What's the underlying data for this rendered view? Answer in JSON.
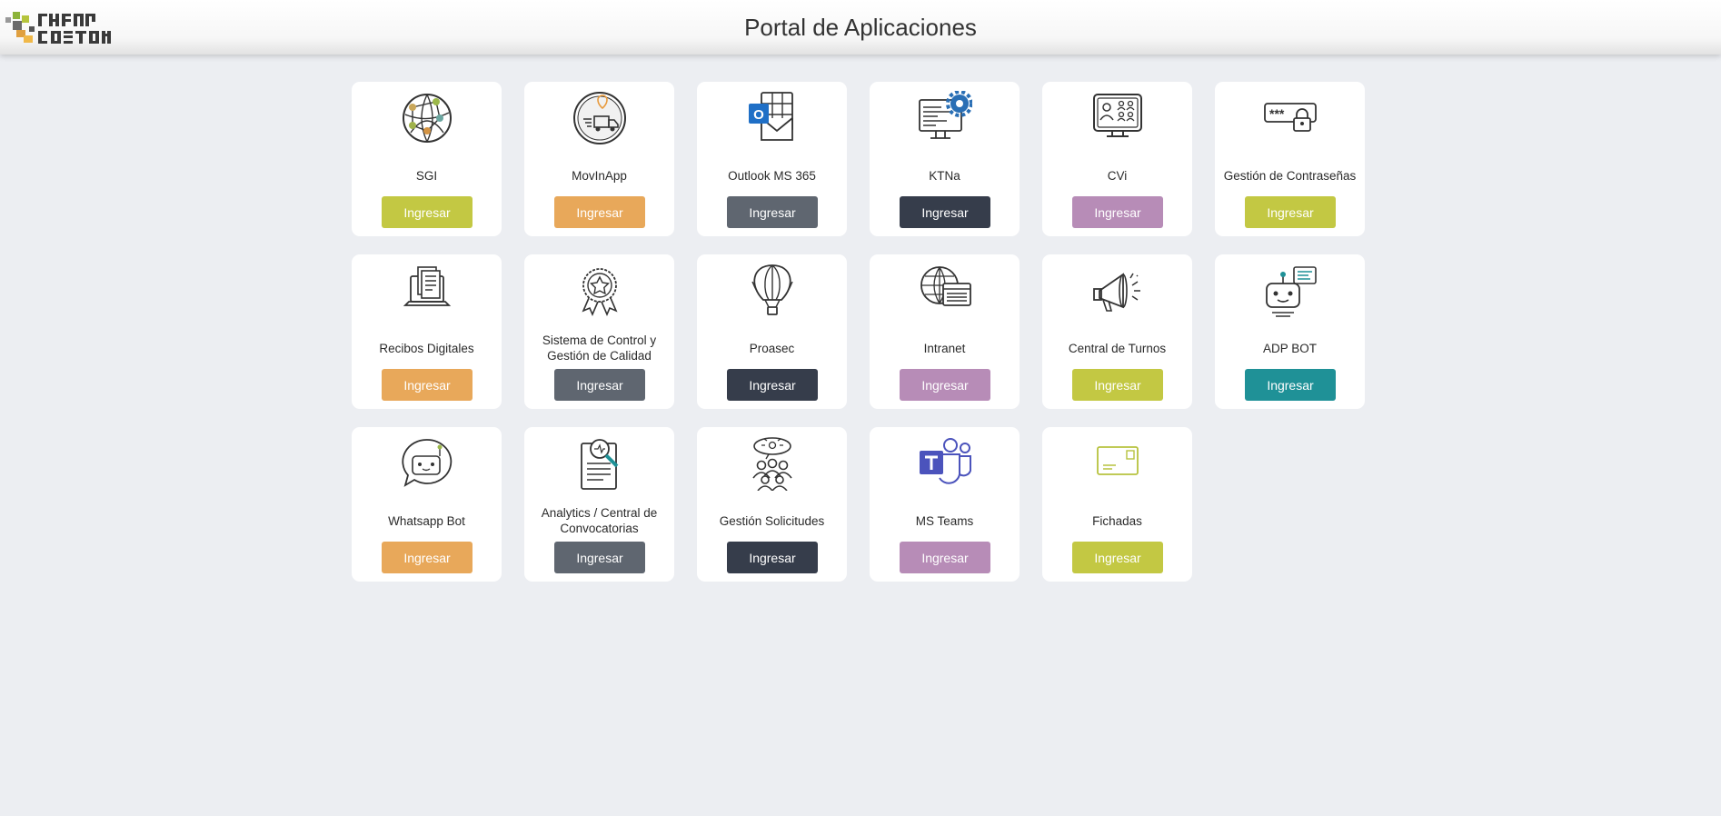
{
  "header": {
    "title": "Portal de Aplicaciones"
  },
  "colors": {
    "lime": "#c3c843",
    "orange": "#e8a85a",
    "slate": "#5f6670",
    "navy": "#363d4b",
    "mauve": "#b78cb7",
    "teal": "#1f9197",
    "card_bg": "#ffffff",
    "page_bg": "#eceef2"
  },
  "apps": [
    {
      "label": "SGI",
      "button": "Ingresar",
      "icon": "network-globe-icon",
      "color": "lime"
    },
    {
      "label": "MovInApp",
      "button": "Ingresar",
      "icon": "delivery-truck-icon",
      "color": "orange"
    },
    {
      "label": "Outlook MS 365",
      "button": "Ingresar",
      "icon": "outlook-icon",
      "color": "slate"
    },
    {
      "label": "KTNa",
      "button": "Ingresar",
      "icon": "monitor-gear-icon",
      "color": "navy"
    },
    {
      "label": "CVi",
      "button": "Ingresar",
      "icon": "monitor-people-icon",
      "color": "mauve"
    },
    {
      "label": "Gestión de Contraseñas",
      "button": "Ingresar",
      "icon": "password-lock-icon",
      "color": "lime"
    },
    {
      "label": "Recibos Digitales",
      "button": "Ingresar",
      "icon": "laptop-documents-icon",
      "color": "orange"
    },
    {
      "label": "Sistema de Control y Gestión de Calidad",
      "button": "Ingresar",
      "icon": "quality-badge-icon",
      "color": "slate"
    },
    {
      "label": "Proasec",
      "button": "Ingresar",
      "icon": "hot-air-balloon-icon",
      "color": "navy"
    },
    {
      "label": "Intranet",
      "button": "Ingresar",
      "icon": "globe-window-icon",
      "color": "mauve"
    },
    {
      "label": "Central de Turnos",
      "button": "Ingresar",
      "icon": "megaphone-icon",
      "color": "lime"
    },
    {
      "label": "ADP BOT",
      "button": "Ingresar",
      "icon": "robot-chat-icon",
      "color": "teal"
    },
    {
      "label": "Whatsapp Bot",
      "button": "Ingresar",
      "icon": "chat-robot-icon",
      "color": "orange"
    },
    {
      "label": "Analytics / Central de Convocatorias",
      "button": "Ingresar",
      "icon": "clipboard-search-icon",
      "color": "slate"
    },
    {
      "label": "Gestión Solicitudes",
      "button": "Ingresar",
      "icon": "team-ideas-icon",
      "color": "navy"
    },
    {
      "label": "MS Teams",
      "button": "Ingresar",
      "icon": "teams-icon",
      "color": "mauve"
    },
    {
      "label": "Fichadas",
      "button": "Ingresar",
      "icon": "envelope-icon",
      "color": "lime"
    }
  ]
}
